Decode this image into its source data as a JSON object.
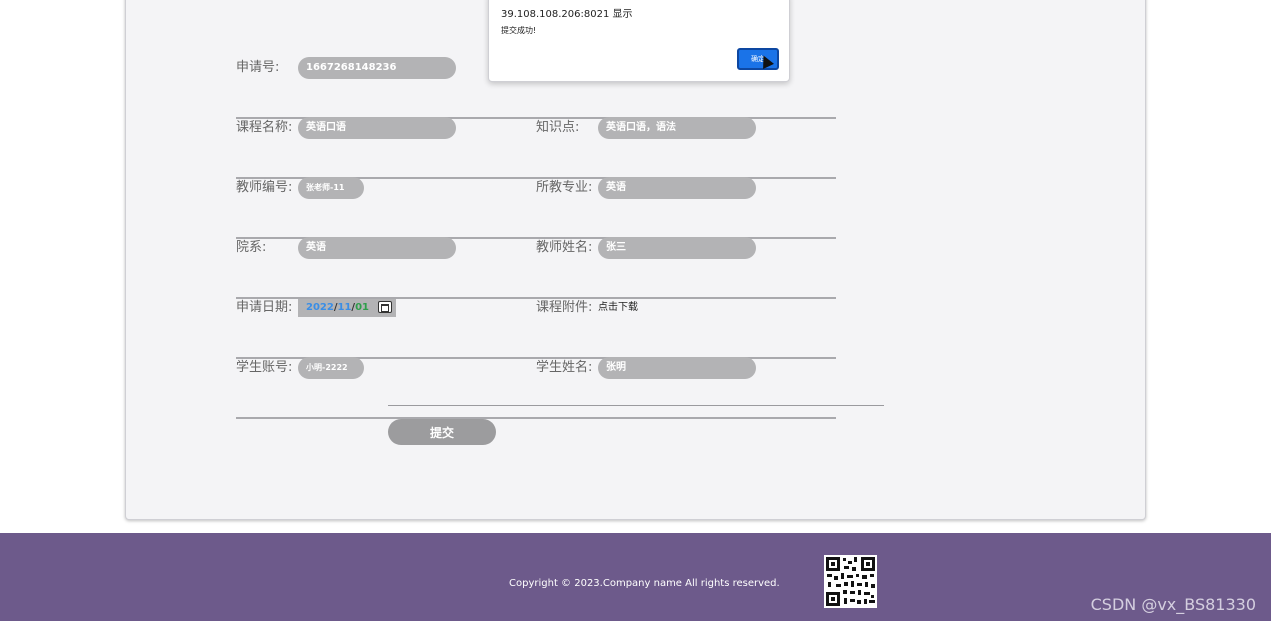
{
  "dialog": {
    "origin": "39.108.108.206:8021 显示",
    "message": "提交成功!",
    "ok_label": "确定"
  },
  "form": {
    "application_no": {
      "label": "申请号:",
      "value": "1667268148236"
    },
    "course_name": {
      "label": "课程名称:",
      "value": "英语口语"
    },
    "knowledge": {
      "label": "知识点:",
      "value": "英语口语，语法"
    },
    "teacher_no": {
      "label": "教师编号:",
      "value": "张老师-11"
    },
    "major": {
      "label": "所教专业:",
      "value": "英语"
    },
    "department": {
      "label": "院系:",
      "value": "英语"
    },
    "teacher_name": {
      "label": "教师姓名:",
      "value": "张三"
    },
    "apply_date": {
      "label": "申请日期:",
      "year": "2022",
      "month": "11",
      "day": "01",
      "sep": "/"
    },
    "attachment": {
      "label": "课程附件:",
      "value": "点击下载"
    },
    "student_account": {
      "label": "学生账号:",
      "value": "小明-2222"
    },
    "student_name": {
      "label": "学生姓名:",
      "value": "张明"
    },
    "submit_label": "提交"
  },
  "footer": {
    "copyright": "Copyright © 2023.Company name All rights reserved.",
    "watermark": "CSDN @vx_BS81330"
  },
  "colors": {
    "footer_bg": "#6d5a8b",
    "pill_bg": "#b3b3b5",
    "dialog_button": "#1a73e8"
  },
  "icons": {
    "date_picker": "calendar-icon",
    "qr": "qr-code-icon"
  }
}
